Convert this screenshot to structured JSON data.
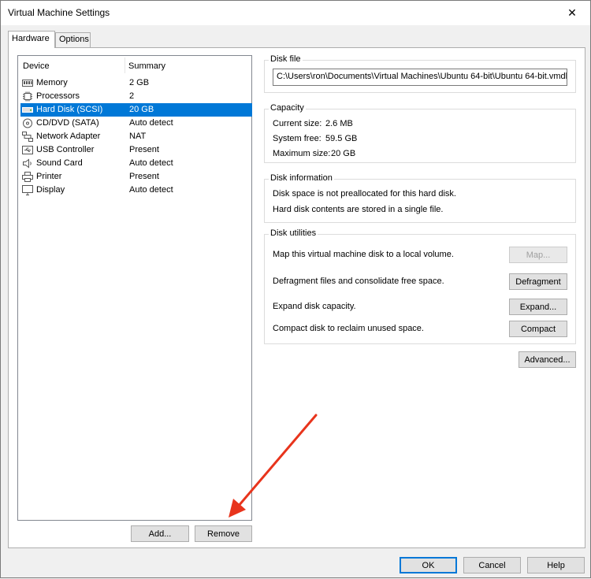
{
  "window": {
    "title": "Virtual Machine Settings",
    "close_glyph": "✕"
  },
  "tabs": [
    {
      "label": "Hardware",
      "active": true
    },
    {
      "label": "Options",
      "active": false
    }
  ],
  "device_list": {
    "headers": {
      "device": "Device",
      "summary": "Summary"
    },
    "rows": [
      {
        "name": "Memory",
        "summary": "2 GB",
        "icon": "memory-icon",
        "selected": false
      },
      {
        "name": "Processors",
        "summary": "2",
        "icon": "processor-icon",
        "selected": false
      },
      {
        "name": "Hard Disk (SCSI)",
        "summary": "20 GB",
        "icon": "hard-disk-icon",
        "selected": true
      },
      {
        "name": "CD/DVD (SATA)",
        "summary": "Auto detect",
        "icon": "cd-dvd-icon",
        "selected": false
      },
      {
        "name": "Network Adapter",
        "summary": "NAT",
        "icon": "network-adapter-icon",
        "selected": false
      },
      {
        "name": "USB Controller",
        "summary": "Present",
        "icon": "usb-icon",
        "selected": false
      },
      {
        "name": "Sound Card",
        "summary": "Auto detect",
        "icon": "sound-card-icon",
        "selected": false
      },
      {
        "name": "Printer",
        "summary": "Present",
        "icon": "printer-icon",
        "selected": false
      },
      {
        "name": "Display",
        "summary": "Auto detect",
        "icon": "display-icon",
        "selected": false
      }
    ],
    "add_label": "Add...",
    "remove_label": "Remove"
  },
  "disk_file": {
    "title": "Disk file",
    "path": "C:\\Users\\ron\\Documents\\Virtual Machines\\Ubuntu 64-bit\\Ubuntu 64-bit.vmdk"
  },
  "capacity": {
    "title": "Capacity",
    "current_size_label": "Current size:",
    "current_size": "2.6 MB",
    "system_free_label": "System free:",
    "system_free": "59.5 GB",
    "maximum_size_label": "Maximum size:",
    "maximum_size": "20 GB"
  },
  "disk_information": {
    "title": "Disk information",
    "line1": "Disk space is not preallocated for this hard disk.",
    "line2": "Hard disk contents are stored in a single file."
  },
  "disk_utilities": {
    "title": "Disk utilities",
    "map_text": "Map this virtual machine disk to a local volume.",
    "map_label": "Map...",
    "defragment_text": "Defragment files and consolidate free space.",
    "defragment_label": "Defragment",
    "expand_text": "Expand disk capacity.",
    "expand_label": "Expand...",
    "compact_text": "Compact disk to reclaim unused space.",
    "compact_label": "Compact"
  },
  "advanced_label": "Advanced...",
  "footer": {
    "ok_label": "OK",
    "cancel_label": "Cancel",
    "help_label": "Help"
  },
  "colors": {
    "selection": "#0078d7",
    "annotation_arrow": "#e8341c"
  },
  "annotation": {
    "arrow_target": "remove-button"
  }
}
